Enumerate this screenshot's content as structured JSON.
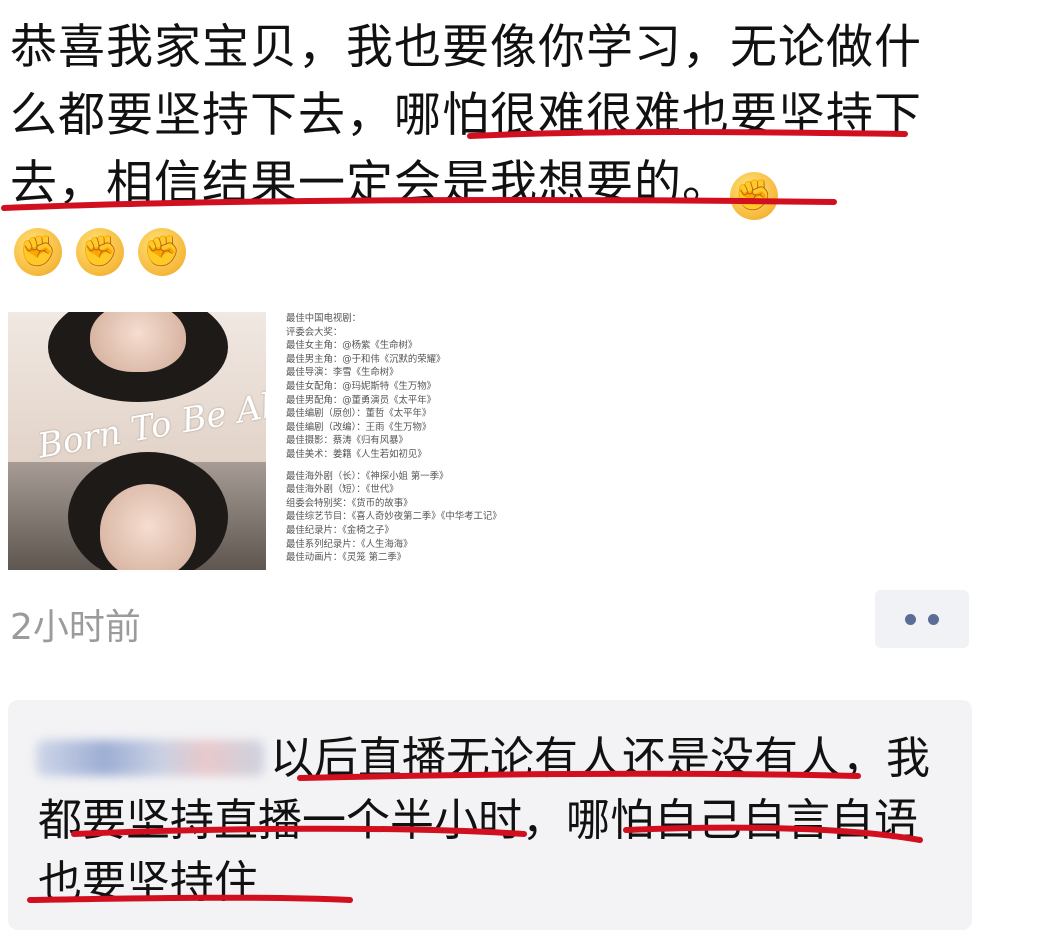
{
  "post": {
    "text": "恭喜我家宝贝，我也要像你学习，无论做什么都要坚持下去，哪怕很难很难也要坚持下去，相信结果一定会是我想要的。",
    "emoji_icon": "raised-fist-emoji",
    "emoji_count_inline": 1,
    "emoji_count_row": 3,
    "timestamp": "2小时前"
  },
  "images": {
    "poster_title": "Born To Be Alive",
    "awards_lines": [
      "最佳中国电视剧：",
      "评委会大奖：",
      "最佳女主角：@杨紫《生命树》",
      "最佳男主角：@于和伟《沉默的荣耀》",
      "最佳导演：李雪《生命树》",
      "最佳女配角：@玛妮斯特《生万物》",
      "最佳男配角：@董勇演员《太平年》",
      "最佳编剧（原创）：董哲《太平年》",
      "最佳编剧（改编）：王雨《生万物》",
      "最佳摄影：蔡涛《归有风暴》",
      "最佳美术：姜籍《人生若如初见》",
      "",
      "最佳海外剧（长）：《神探小姐 第一季》",
      "最佳海外剧（短）：《世代》",
      "组委会特别奖：《货币的故事》",
      "最佳综艺节目：《喜人奇妙夜第二季》《中华考工记》",
      "最佳纪录片：《金椅之子》",
      "最佳系列纪录片：《人生海海》",
      "最佳动画片：《灵笼 第二季》"
    ]
  },
  "more_button": {
    "icon": "more-dots-icon"
  },
  "comment": {
    "text": "以后直播无论有人还是没有人，我都要坚持直播一个半小时，哪怕自己自言自语也要坚持住"
  },
  "colors": {
    "underline": "#d10f1f",
    "timestamp": "#9b9b9b",
    "comment_bg": "#f3f3f5",
    "more_dots": "#5a6d96"
  }
}
